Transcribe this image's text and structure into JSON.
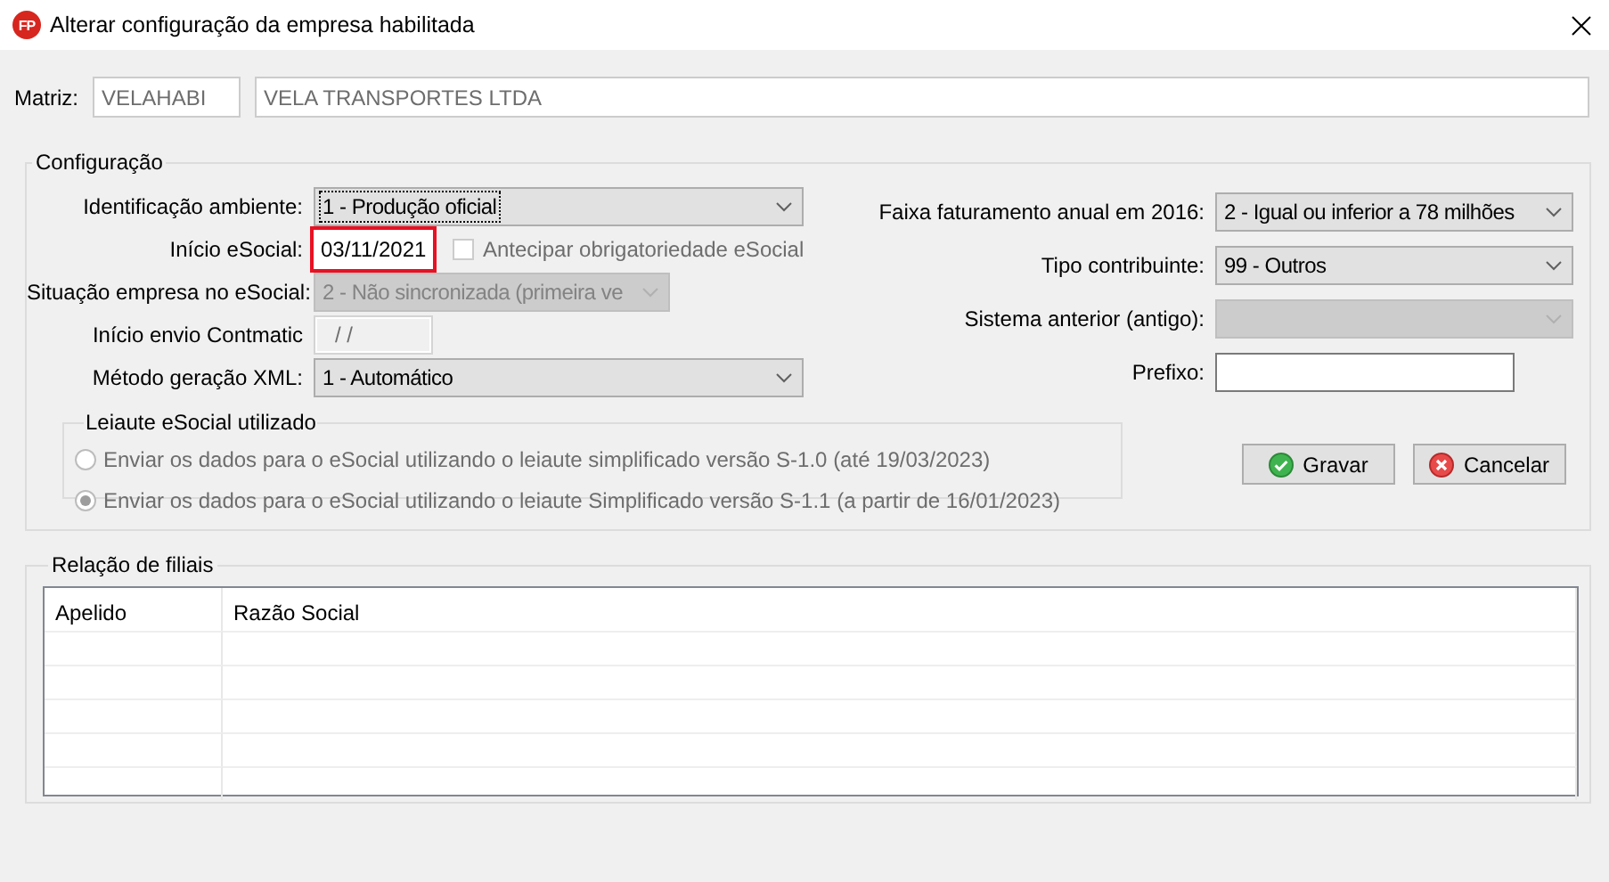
{
  "window": {
    "logo": "FP",
    "title": "Alterar configuração da empresa habilitada"
  },
  "matriz": {
    "label": "Matriz:",
    "code": "VELAHABI",
    "name": "VELA TRANSPORTES LTDA"
  },
  "configuracao": {
    "title": "Configuração",
    "fields_left": [
      {
        "kind": "combo",
        "label": "Identificação ambiente:",
        "value": "1 - Produção oficial",
        "disabled": false,
        "focused": true,
        "highlighted": false
      },
      {
        "kind": "date",
        "label": "Início eSocial:",
        "value": "03/11/2021",
        "disabled": false,
        "focused": false,
        "highlighted": true,
        "checkbox": {
          "label": "Antecipar obrigatoriedade eSocial",
          "checked": false,
          "disabled": true
        }
      },
      {
        "kind": "combo",
        "label": "Situação empresa no eSocial:",
        "value": "2 - Não sincronizada (primeira ve",
        "disabled": true,
        "focused": false,
        "highlighted": false
      },
      {
        "kind": "date",
        "label": "Início envio Contmatic",
        "value": "/ /",
        "disabled": true,
        "focused": false,
        "highlighted": false
      },
      {
        "kind": "combo",
        "label": "Método geração XML:",
        "value": "1 - Automático",
        "disabled": false,
        "focused": false,
        "highlighted": false
      }
    ],
    "fields_right": [
      {
        "kind": "combo",
        "label": "Faixa faturamento anual em 2016:",
        "value": "2 - Igual ou inferior a 78 milhões",
        "disabled": false,
        "focused": false,
        "highlighted": false
      },
      {
        "kind": "combo",
        "label": "Tipo contribuinte:",
        "value": "99 - Outros",
        "disabled": false,
        "focused": false,
        "highlighted": false
      },
      {
        "kind": "combo",
        "label": "Sistema anterior (antigo):",
        "disabled": true,
        "focused": false,
        "highlighted": false
      },
      {
        "kind": "text",
        "label": "Prefixo:",
        "disabled": false,
        "focused": false,
        "highlighted": false
      }
    ],
    "leiaute": {
      "title": "Leiaute eSocial utilizado",
      "disabled": true,
      "options": [
        {
          "label": "Enviar os dados para o eSocial utilizando o leiaute simplificado versão S-1.0 (até 19/03/2023)",
          "selected": false
        },
        {
          "label": "Enviar os dados para o eSocial utilizando o leiaute Simplificado versão S-1.1 (a partir de 16/01/2023)",
          "selected": true
        }
      ]
    },
    "buttons": [
      {
        "kind": "save",
        "label": "Gravar"
      },
      {
        "kind": "cancel",
        "label": "Cancelar"
      }
    ]
  },
  "filiais": {
    "title": "Relação de filiais",
    "columns": [
      "Apelido",
      "Razão Social"
    ]
  }
}
